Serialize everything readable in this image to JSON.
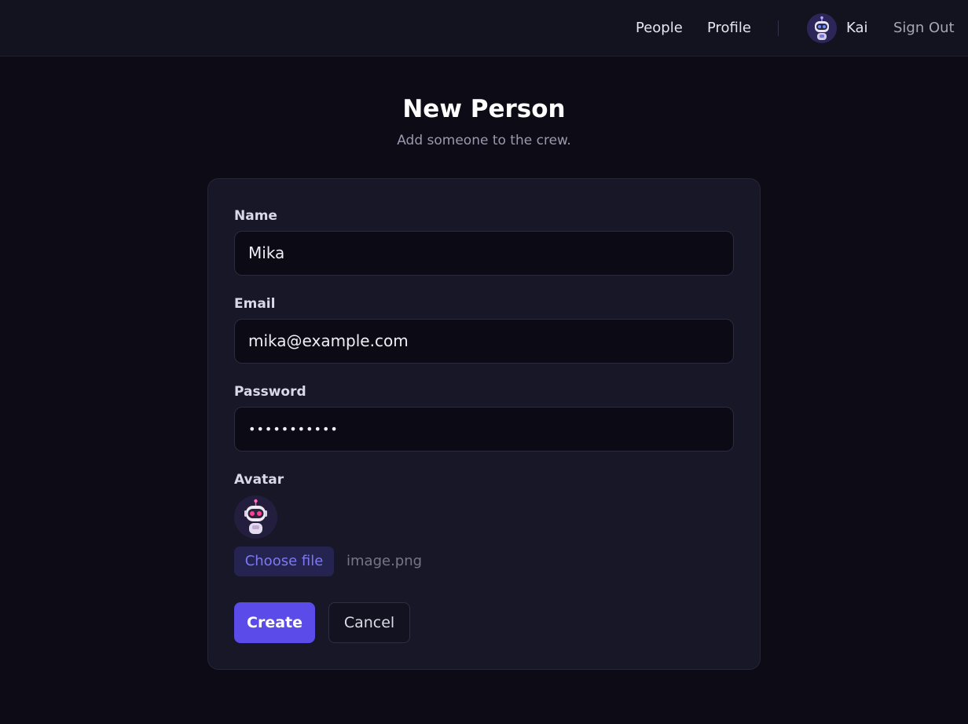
{
  "nav": {
    "people_label": "People",
    "profile_label": "Profile",
    "user_name": "Kai",
    "signout_label": "Sign Out",
    "avatar_icon": "robot-avatar-icon"
  },
  "header": {
    "title": "New Person",
    "subtitle": "Add someone to the crew."
  },
  "form": {
    "name": {
      "label": "Name",
      "value": "Mika"
    },
    "email": {
      "label": "Email",
      "value": "mika@example.com"
    },
    "password": {
      "label": "Password",
      "value": "•••••••••••"
    },
    "avatar": {
      "label": "Avatar",
      "choose_label": "Choose file",
      "file_name": "image.png",
      "preview_icon": "pink-robot-avatar-icon"
    },
    "create_label": "Create",
    "cancel_label": "Cancel"
  },
  "colors": {
    "accent": "#5b4be8",
    "background": "#0c0b16",
    "card": "#181728",
    "link_accent": "#7e78f5"
  }
}
